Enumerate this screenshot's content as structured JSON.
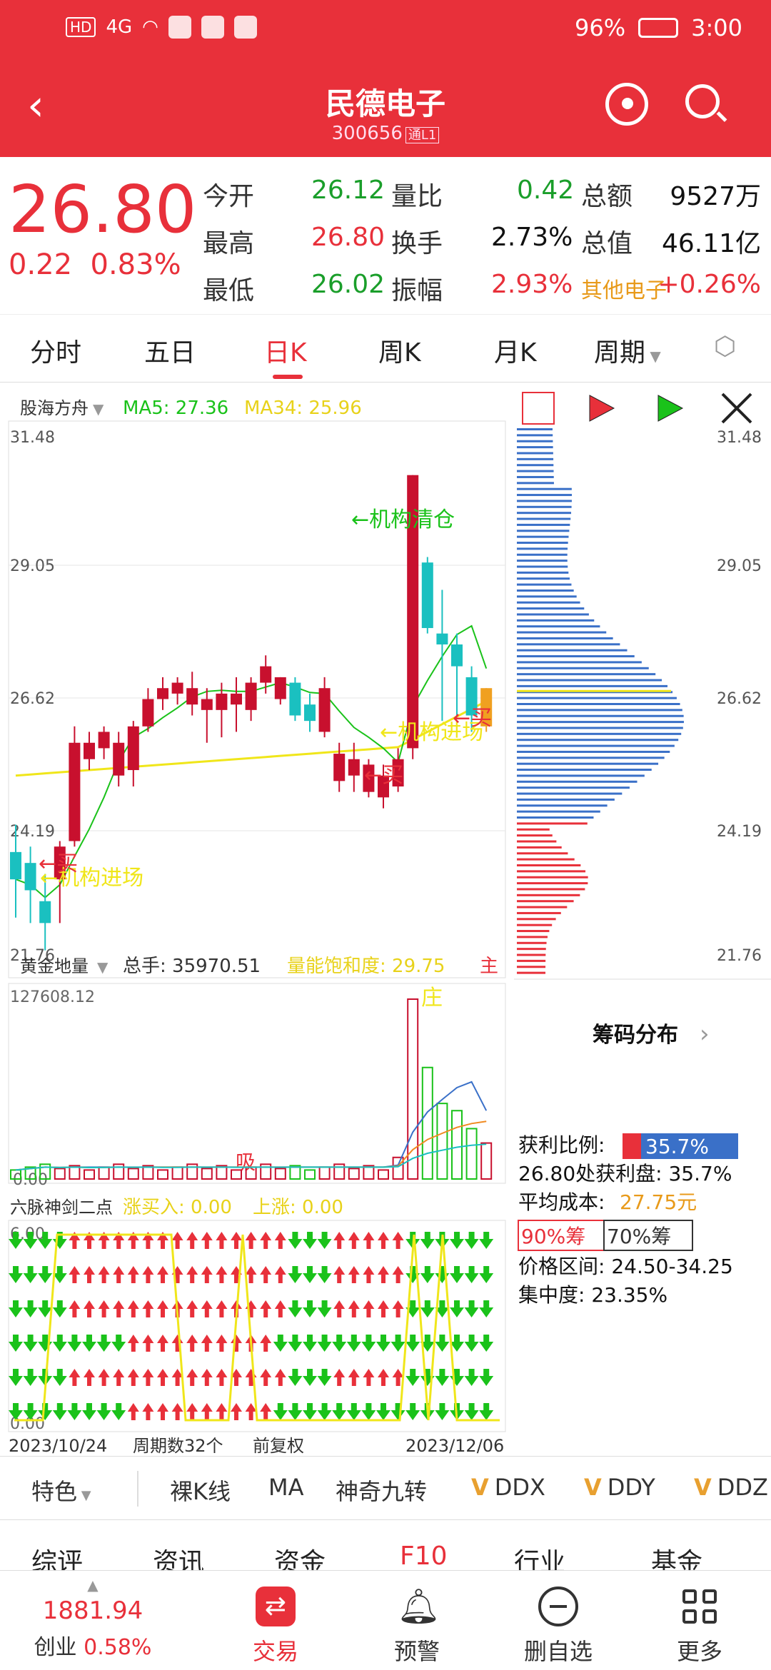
{
  "status": {
    "battery": "96%",
    "time": "3:00",
    "net": "4G"
  },
  "header": {
    "title": "民德电子",
    "code": "300656",
    "tag": "通L1"
  },
  "quote": {
    "price": "26.80",
    "change": "0.22",
    "change_pct": "0.83%",
    "rows": [
      {
        "l1": "今开",
        "v1": "26.12",
        "l2": "量比",
        "v2": "0.42",
        "l3": "总额",
        "v3": "9527万"
      },
      {
        "l1": "最高",
        "v1": "26.80",
        "l2": "换手",
        "v2": "2.73%",
        "l3": "总值",
        "v3": "46.11亿"
      },
      {
        "l1": "最低",
        "v1": "26.02",
        "l2": "振幅",
        "v2": "2.93%",
        "l3": "其他电子",
        "v3": "+0.26%"
      }
    ]
  },
  "tabs": [
    "分时",
    "五日",
    "日K",
    "周K",
    "月K",
    "周期"
  ],
  "chart_labels": {
    "indicator": "股海方舟",
    "ma5": "MA5: 27.36",
    "ma34": "MA34: 25.96",
    "y_ticks": [
      "31.48",
      "29.05",
      "26.62",
      "24.19",
      "21.76"
    ],
    "ann_clear": "←机构清仓",
    "ann_enter1": "←机构进场",
    "ann_enter2": "←机构进场",
    "ann_buy1": "←买",
    "ann_buy2": "←买",
    "ann_buy3": "←买",
    "vol_ind": "黄金地量",
    "vol_total": "总手: 35970.51",
    "vol_sat": "量能饱和度: 29.75",
    "vol_main": "主",
    "vol_zhuang": "庄",
    "vol_max": "127608.12",
    "vol_min": "0.00",
    "vol_xi": "吸",
    "six": "六脉神剑二点",
    "six_buy": "涨买入: 0.00",
    "six_up": "上涨: 0.00",
    "six_top": "6.00",
    "six_bot": "0.00",
    "date_start": "2023/10/24",
    "period": "周期数32个",
    "adjust": "前复权",
    "date_end": "2023/12/06",
    "chip_title": "筹码分布",
    "chip_profit_lbl": "获利比例:",
    "chip_profit_val": "35.7%",
    "chip_line1": "26.80处获利盘: 35.7%",
    "chip_cost_lbl": "平均成本:",
    "chip_cost_val": "27.75元",
    "chip_90": "90%筹",
    "chip_70": "70%筹",
    "chip_range": "价格区间: 24.50-34.25",
    "chip_conc": "集中度: 23.35%"
  },
  "bottom_tabs": [
    "特色",
    "裸K线",
    "MA",
    "神奇九转",
    "DDX",
    "DDY",
    "DDZ"
  ],
  "sub_tabs": [
    "综评",
    "资讯",
    "资金",
    "F10",
    "行业",
    "基金"
  ],
  "nav": {
    "index_value": "1881.94",
    "index_name": "创业",
    "index_pct": "0.58%",
    "trade": "交易",
    "alert": "预警",
    "remove": "删自选",
    "more": "更多"
  },
  "chart_data": {
    "type": "candlestick",
    "date_range": [
      "2023/10/24",
      "2023/12/06"
    ],
    "ylim": [
      21.76,
      31.48
    ],
    "y_ticks": [
      31.48,
      29.05,
      26.62,
      24.19,
      21.76
    ],
    "candles": [
      {
        "o": 23.8,
        "c": 23.3,
        "h": 24.3,
        "l": 22.6
      },
      {
        "o": 23.6,
        "c": 23.1,
        "h": 23.9,
        "l": 22.5
      },
      {
        "o": 22.9,
        "c": 22.5,
        "h": 23.4,
        "l": 22.0
      },
      {
        "o": 23.3,
        "c": 23.9,
        "h": 24.0,
        "l": 22.5
      },
      {
        "o": 24.0,
        "c": 25.8,
        "h": 26.1,
        "l": 23.9
      },
      {
        "o": 25.5,
        "c": 25.8,
        "h": 26.0,
        "l": 25.3
      },
      {
        "o": 25.7,
        "c": 26.0,
        "h": 26.1,
        "l": 25.5
      },
      {
        "o": 25.2,
        "c": 25.8,
        "h": 26.0,
        "l": 25.0
      },
      {
        "o": 25.3,
        "c": 26.1,
        "h": 26.2,
        "l": 25.0
      },
      {
        "o": 26.1,
        "c": 26.6,
        "h": 26.8,
        "l": 26.0
      },
      {
        "o": 26.6,
        "c": 26.8,
        "h": 27.0,
        "l": 26.4
      },
      {
        "o": 26.7,
        "c": 26.9,
        "h": 27.0,
        "l": 26.5
      },
      {
        "o": 26.5,
        "c": 26.8,
        "h": 27.1,
        "l": 26.3
      },
      {
        "o": 26.4,
        "c": 26.6,
        "h": 26.8,
        "l": 25.8
      },
      {
        "o": 26.4,
        "c": 26.7,
        "h": 26.9,
        "l": 25.9
      },
      {
        "o": 26.5,
        "c": 26.7,
        "h": 27.0,
        "l": 26.0
      },
      {
        "o": 26.4,
        "c": 26.9,
        "h": 27.0,
        "l": 26.2
      },
      {
        "o": 26.9,
        "c": 27.2,
        "h": 27.4,
        "l": 26.7
      },
      {
        "o": 26.6,
        "c": 27.0,
        "h": 27.0,
        "l": 26.5
      },
      {
        "o": 26.9,
        "c": 26.3,
        "h": 27.0,
        "l": 26.2
      },
      {
        "o": 26.5,
        "c": 26.2,
        "h": 26.7,
        "l": 26.0
      },
      {
        "o": 26.0,
        "c": 26.8,
        "h": 27.0,
        "l": 25.9
      },
      {
        "o": 25.1,
        "c": 25.6,
        "h": 25.8,
        "l": 24.9
      },
      {
        "o": 25.2,
        "c": 25.5,
        "h": 25.8,
        "l": 24.9
      },
      {
        "o": 24.9,
        "c": 25.4,
        "h": 25.5,
        "l": 24.8
      },
      {
        "o": 24.8,
        "c": 25.2,
        "h": 25.4,
        "l": 24.6
      },
      {
        "o": 25.0,
        "c": 25.5,
        "h": 25.7,
        "l": 24.9
      },
      {
        "o": 25.7,
        "c": 30.7,
        "h": 30.7,
        "l": 25.5
      },
      {
        "o": 29.1,
        "c": 27.9,
        "h": 29.2,
        "l": 27.8
      },
      {
        "o": 27.8,
        "c": 27.6,
        "h": 28.6,
        "l": 26.2
      },
      {
        "o": 27.6,
        "c": 27.2,
        "h": 27.8,
        "l": 26.3
      },
      {
        "o": 27.0,
        "c": 26.3,
        "h": 27.2,
        "l": 26.0
      },
      {
        "o": 26.1,
        "c": 26.8,
        "h": 26.8,
        "l": 26.0
      }
    ],
    "volume_max": 127608.12
  }
}
